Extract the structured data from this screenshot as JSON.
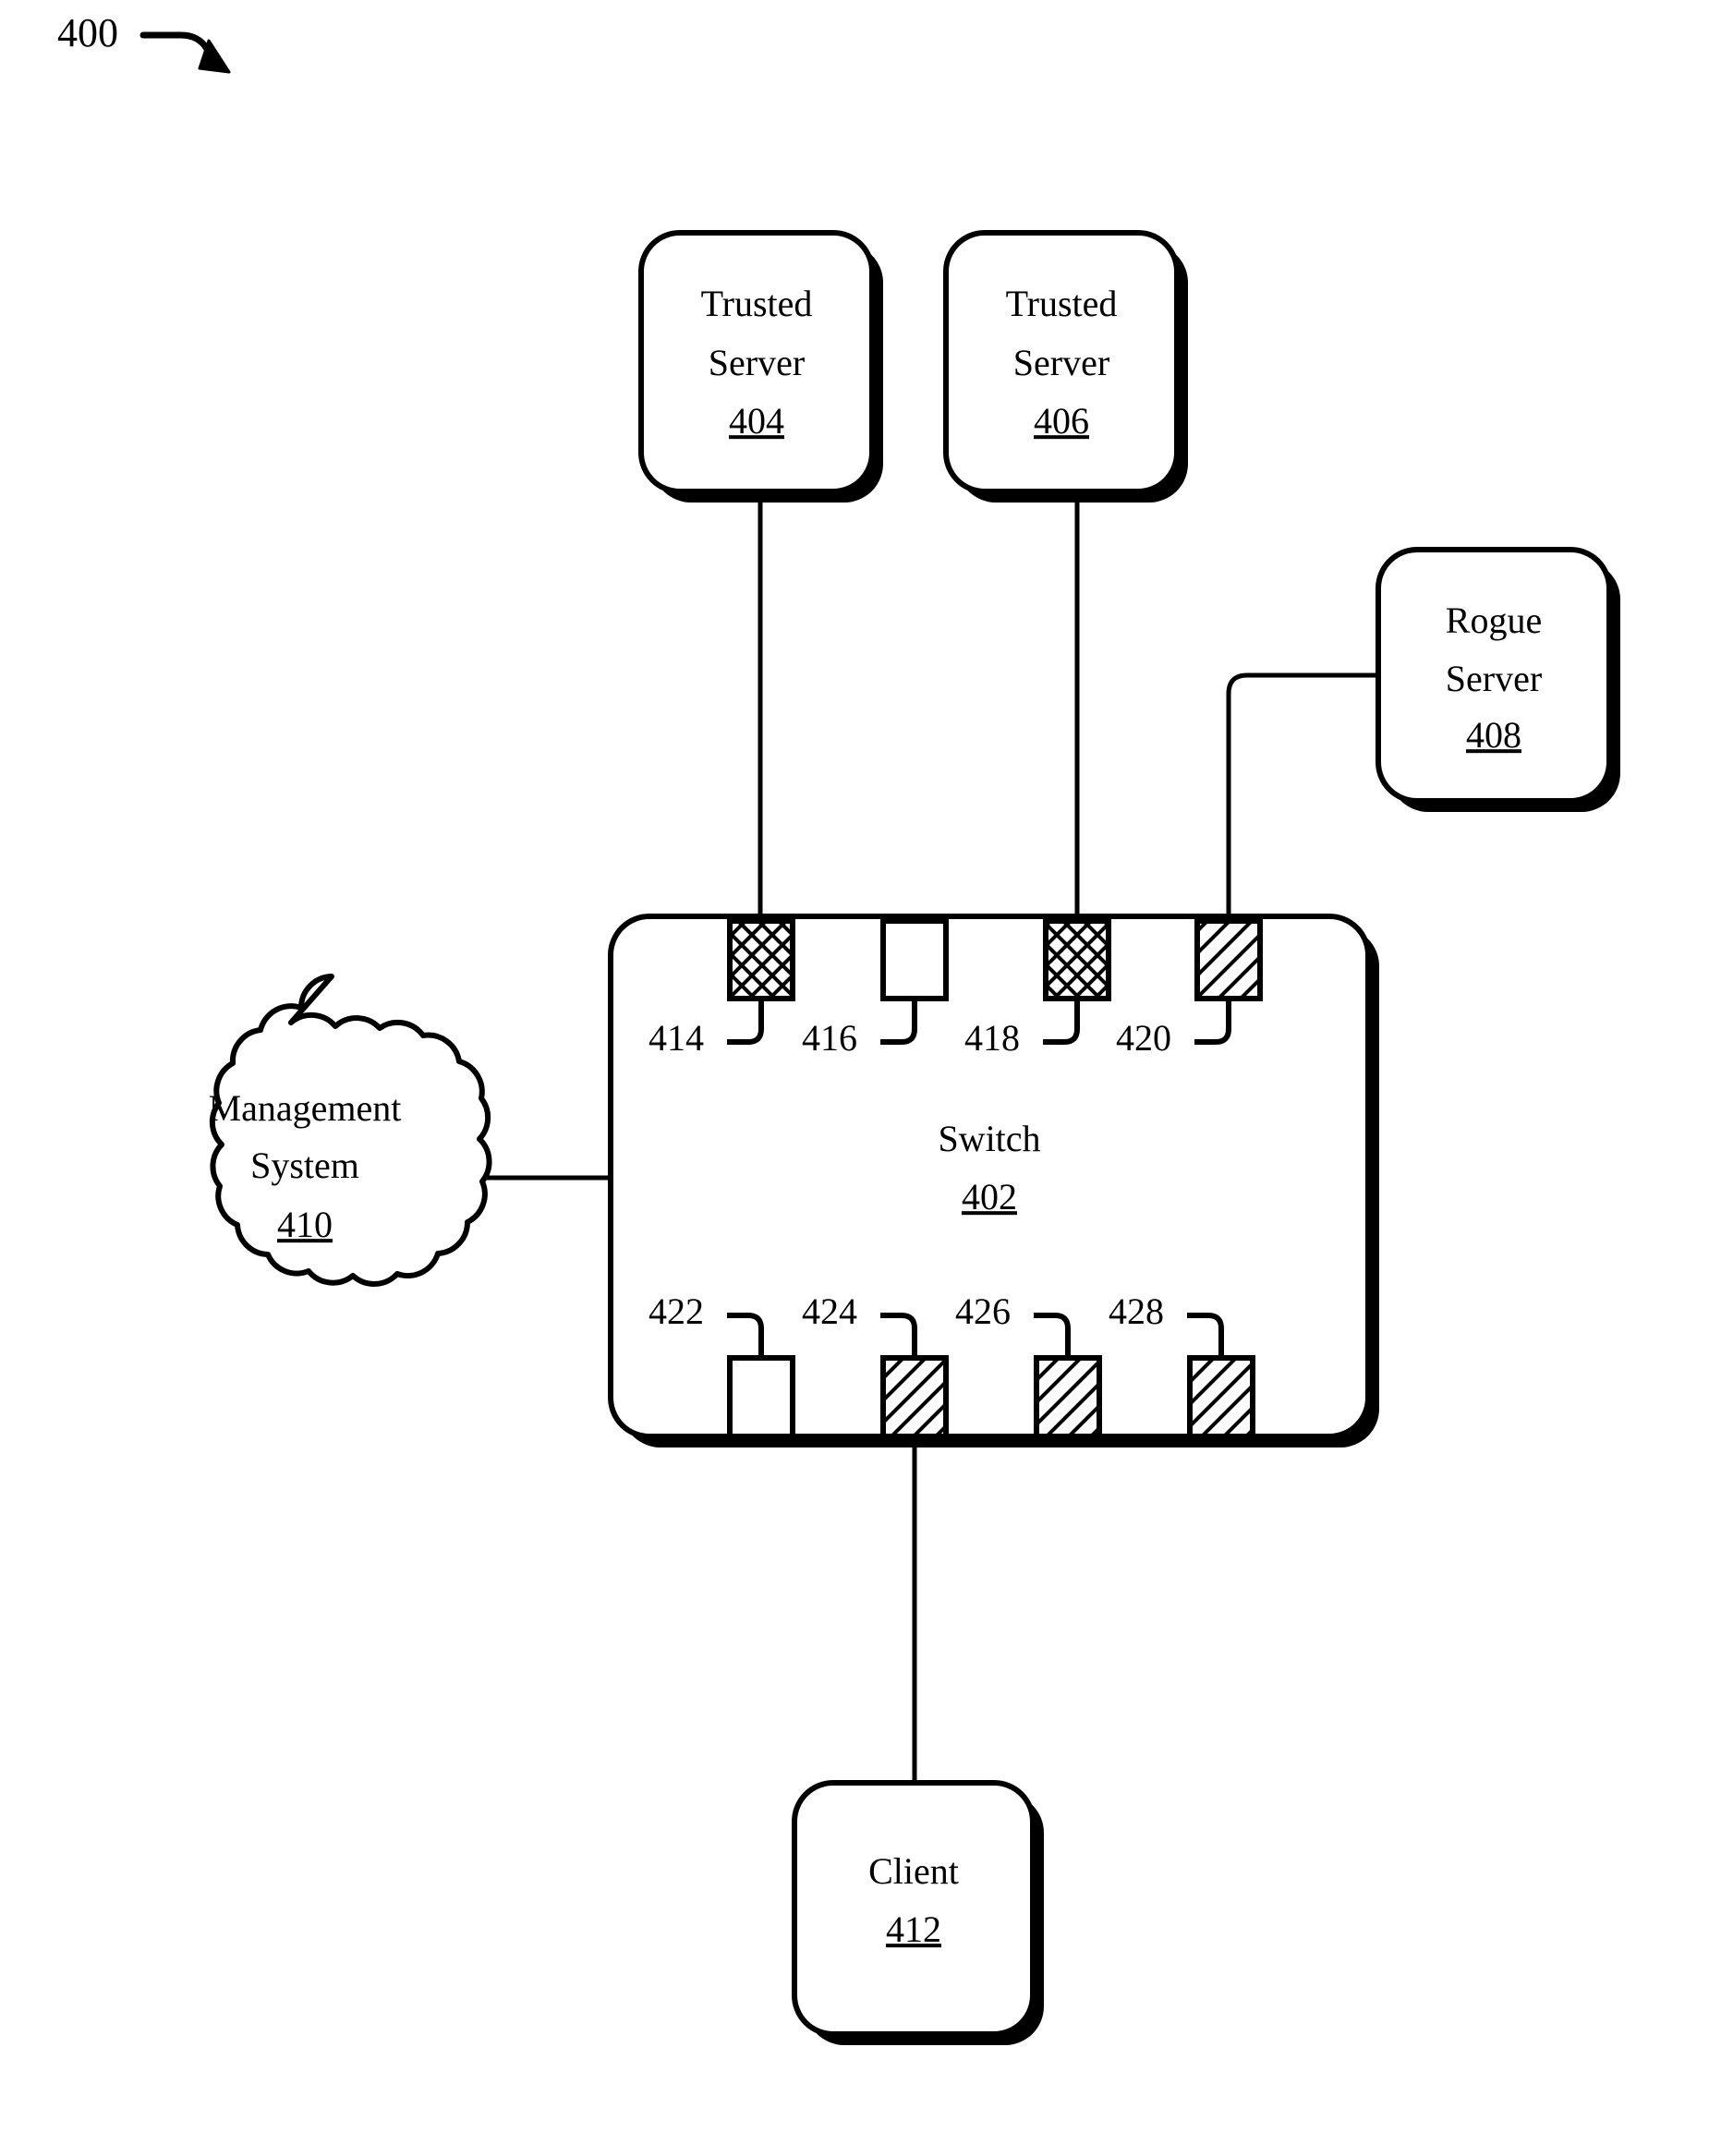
{
  "figure": {
    "number": "400",
    "arrow_icon": "curved-arrow-icon"
  },
  "nodes": {
    "switch": {
      "label": "Switch",
      "ref": "402",
      "shape": "rounded-rectangle"
    },
    "trusted_server_1": {
      "line1": "Trusted",
      "line2": "Server",
      "ref": "404",
      "shape": "rounded-rectangle"
    },
    "trusted_server_2": {
      "line1": "Trusted",
      "line2": "Server",
      "ref": "406",
      "shape": "rounded-rectangle"
    },
    "rogue_server": {
      "line1": "Rogue",
      "line2": "Server",
      "ref": "408",
      "shape": "rounded-rectangle"
    },
    "management_system": {
      "line1": "Management",
      "line2": "System",
      "ref": "410",
      "shape": "cloud"
    },
    "client": {
      "line1": "Client",
      "ref": "412",
      "shape": "rounded-rectangle"
    }
  },
  "ports": {
    "top": [
      {
        "ref": "414",
        "fill": "crosshatch"
      },
      {
        "ref": "416",
        "fill": "none"
      },
      {
        "ref": "418",
        "fill": "crosshatch"
      },
      {
        "ref": "420",
        "fill": "diagonal"
      }
    ],
    "bottom": [
      {
        "ref": "422",
        "fill": "none"
      },
      {
        "ref": "424",
        "fill": "diagonal"
      },
      {
        "ref": "426",
        "fill": "diagonal"
      },
      {
        "ref": "428",
        "fill": "diagonal"
      }
    ]
  },
  "connections": [
    {
      "from": "trusted_server_1",
      "to": "414"
    },
    {
      "from": "trusted_server_2",
      "to": "418"
    },
    {
      "from": "rogue_server",
      "to": "420"
    },
    {
      "from": "management_system",
      "to": "switch"
    },
    {
      "from": "424",
      "to": "client"
    }
  ],
  "colors": {
    "stroke": "#000000",
    "fill": "#ffffff"
  }
}
